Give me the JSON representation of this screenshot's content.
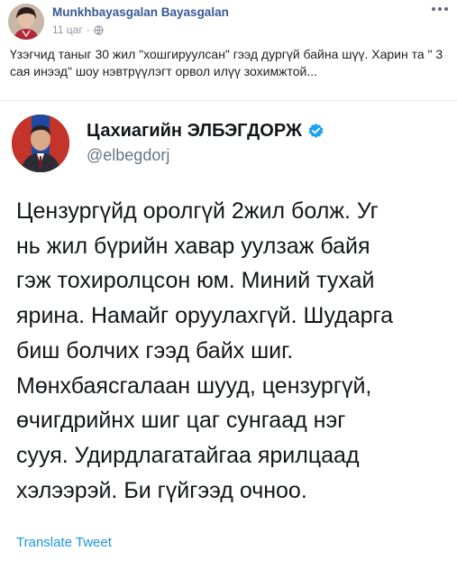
{
  "post": {
    "author_name": "Munkhbayasgalan Bayasgalan",
    "time": "11 цаг",
    "visibility_icon": "globe-icon",
    "more_icon": "more-options-icon",
    "text": "Үзэгчид таныг 30 жил \"хошгируулсан\" гээд дургүй байна шүү. Харин та \" 3 сая инээд\" шоу нэвтрүүлэгт орвол илүү зохимжтой..."
  },
  "tweet": {
    "display_name": "Цахиагийн ЭЛБЭГДОРЖ",
    "handle": "@elbegdorj",
    "verified_icon": "verified-badge-icon",
    "body_lines": [
      "Цензургүйд оролгүй 2жил болж. Уг",
      "нь жил бүрийн хавар уулзаж байя",
      "гэж тохиролцсон юм. Миний тухай",
      "ярина. Намайг оруулахгүй. Шударга",
      "биш болчих гээд байх шиг.",
      "Мөнхбаясгалаан шууд, цензургүй,",
      "өчигдрийнх шиг цаг сунгаад нэг",
      "сууя. Удирдлагатайгаа ярилцаад",
      "хэлээрэй. Би гүйгээд очноо."
    ],
    "translate_label": "Translate Tweet"
  },
  "colors": {
    "fb_link": "#385898",
    "twitter_blue": "#1b95e0",
    "verified": "#1da1f2",
    "muted": "#90949c"
  }
}
